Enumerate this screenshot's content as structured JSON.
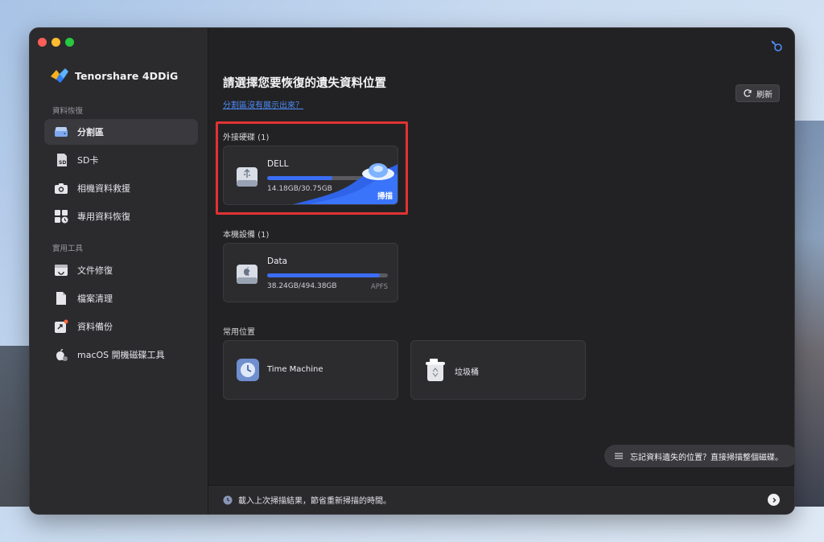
{
  "app": {
    "name": "Tenorshare 4DDiG"
  },
  "sidebar": {
    "section_recovery": "資料恢復",
    "section_tools": "實用工具",
    "items": [
      {
        "label": "分割區",
        "icon": "drive-icon",
        "active": true
      },
      {
        "label": "SD卡",
        "icon": "sd-card-icon",
        "active": false
      },
      {
        "label": "相機資料救援",
        "icon": "camera-icon",
        "active": false
      },
      {
        "label": "專用資料恢復",
        "icon": "special-recovery-icon",
        "active": false
      }
    ],
    "tools": [
      {
        "label": "文件修復",
        "icon": "file-repair-icon"
      },
      {
        "label": "檔案清理",
        "icon": "file-clean-icon"
      },
      {
        "label": "資料備份",
        "icon": "backup-icon"
      },
      {
        "label": "macOS 開機磁碟工具",
        "icon": "apple-boot-icon"
      }
    ]
  },
  "main": {
    "title": "請選擇您要恢復的遺失資料位置",
    "link": "分割區沒有展示出來？",
    "refresh_label": "刷新",
    "external": {
      "label": "外接硬碟 (1)",
      "drive": {
        "name": "DELL",
        "size": "14.18GB/30.75GB",
        "used_fraction": 0.54,
        "scan_label": "掃描"
      }
    },
    "local": {
      "label": "本機設備 (1)",
      "drive": {
        "name": "Data",
        "size": "38.24GB/494.38GB",
        "fs": "APFS",
        "used_fraction": 0.93
      }
    },
    "common": {
      "label": "常用位置",
      "items": [
        {
          "name": "Time Machine",
          "icon": "time-machine-icon"
        },
        {
          "name": "垃圾桶",
          "icon": "trash-icon"
        }
      ]
    },
    "float_tip": "忘記資料遺失的位置？直接掃描整個磁碟。",
    "bottom_tip": "載入上次掃描結果，節省重新掃描的時間。"
  },
  "colors": {
    "accent": "#3b6ef5",
    "highlight": "#e23232",
    "link": "#4f8dfa"
  }
}
